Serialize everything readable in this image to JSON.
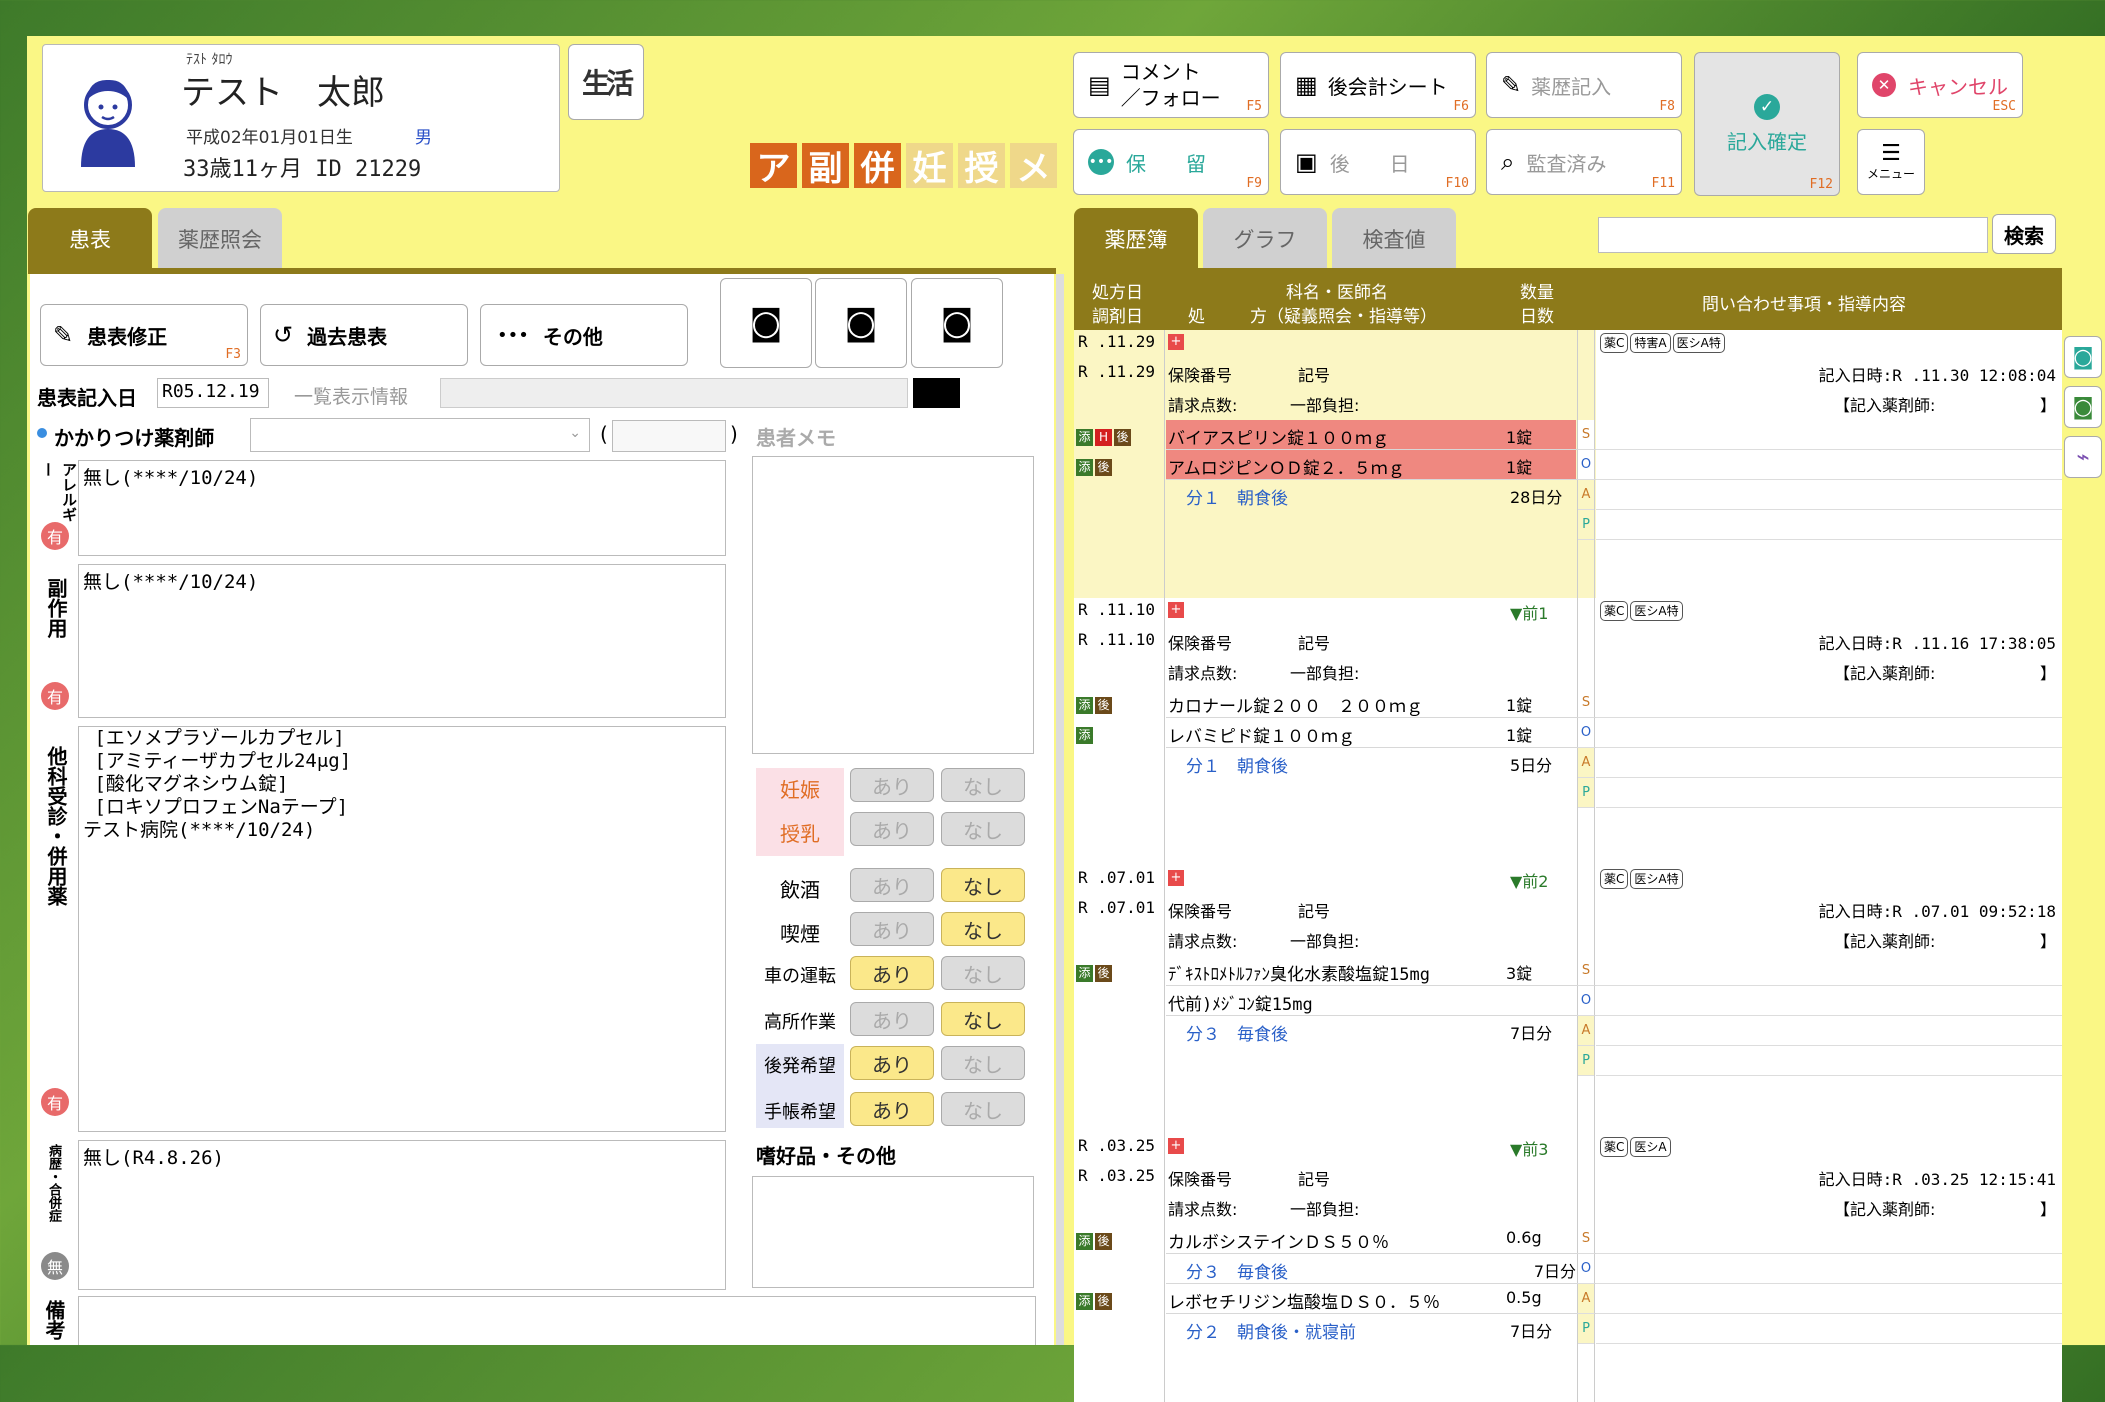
{
  "patient": {
    "kana": "ﾃｽﾄ ﾀﾛｳ",
    "name": "テスト　太郎",
    "birth": "平成02年01月01日生",
    "sex": "男",
    "age_id": "33歳11ヶ月 ID 21229",
    "life_icon": "生活"
  },
  "flags": [
    "ア",
    "副",
    "併",
    "妊",
    "授",
    "メ"
  ],
  "toolbar": {
    "comment": "コメント\n／フォロー",
    "comment_key": "F5",
    "ledger": "後会計シート",
    "ledger_key": "F6",
    "history": "薬歴記入",
    "history_key": "F8",
    "confirm": "記入確定",
    "confirm_key": "F12",
    "cancel": "キャンセル",
    "cancel_key": "ESC",
    "hold": "保　　留",
    "hold_key": "F9",
    "later": "後　　日",
    "later_key": "F10",
    "audited": "監査済み",
    "audited_key": "F11",
    "menu": "メニュー"
  },
  "left_tabs": {
    "tab1": "患表",
    "tab2": "薬歴照会"
  },
  "left_buttons": {
    "edit": "患表修正",
    "edit_key": "F3",
    "past": "過去患表",
    "other": "その他"
  },
  "record_date_label": "患表記入日",
  "record_date": "R05.12.19",
  "list_info_label": "一覧表示情報",
  "pharmacist_label": "かかりつけ薬剤師",
  "memo_label": "患者メモ",
  "sections": {
    "allergy_label": "アレルギー",
    "allergy_text": "無し(****/10/24)",
    "allergy_flag": "有",
    "side_label": "副作用",
    "side_text": "無し(****/10/24)",
    "side_flag": "有",
    "concomitant_label": "他科受診・併用薬",
    "concomitant_text": " [エソメプラゾールカプセル]\n [アミティーザカプセル24μg]\n [酸化マグネシウム錠]\n [ロキソプロフェンNaテープ]\nテスト病院(****/10/24)",
    "concomitant_flag": "有",
    "history_label": "病歴・合併症",
    "history_text": "無し(R4.8.26)",
    "history_flag": "無",
    "remarks_label": "備考"
  },
  "lifestyle": [
    {
      "label": "妊娠",
      "yes": "あり",
      "no": "なし",
      "selected": "none"
    },
    {
      "label": "授乳",
      "yes": "あり",
      "no": "なし",
      "selected": "none"
    },
    {
      "label": "飲酒",
      "yes": "あり",
      "no": "なし",
      "selected": "no"
    },
    {
      "label": "喫煙",
      "yes": "あり",
      "no": "なし",
      "selected": "no"
    },
    {
      "label": "車の運転",
      "yes": "あり",
      "no": "なし",
      "selected": "yes"
    },
    {
      "label": "高所作業",
      "yes": "あり",
      "no": "なし",
      "selected": "no"
    },
    {
      "label": "後発希望",
      "yes": "あり",
      "no": "なし",
      "selected": "yes"
    },
    {
      "label": "手帳希望",
      "yes": "あり",
      "no": "なし",
      "selected": "yes"
    }
  ],
  "hobby_label": "嗜好品・その他",
  "right_tabs": {
    "tab1": "薬歴簿",
    "tab2": "グラフ",
    "tab3": "検査値",
    "search": "検索"
  },
  "table_head": {
    "c1a": "処方日",
    "c1b": "調剤日",
    "c2": "処",
    "c3a": "科名・医師名",
    "c3b": "方（疑義照会・指導等）",
    "c4a": "数量",
    "c4b": "日数",
    "c5": "問い合わせ事項・指導内容"
  },
  "records": [
    {
      "date1": "R .11.29",
      "date2": "R .11.29",
      "prev": "",
      "badges": [
        "薬C",
        "特害A",
        "医シA特"
      ],
      "insurance": "保険番号",
      "symbol": "記号",
      "points": "請求点数:",
      "copay": "一部負担:",
      "entry_time": "記入日時:R .11.30 12:08:04",
      "pharmacist": "【記入薬剤師:",
      "drugs": [
        {
          "name": "バイアスピリン錠１００ｍｇ",
          "qty": "1錠",
          "hl": true,
          "icons": [
            "添",
            "H",
            "後"
          ]
        },
        {
          "name": "アムロジピンＯＤ錠２．５ｍｇ",
          "qty": "1錠",
          "hl": true,
          "icons": [
            "添",
            "後"
          ]
        }
      ],
      "usage": "分１　朝食後",
      "days": "28日分"
    },
    {
      "date1": "R .11.10",
      "date2": "R .11.10",
      "prev": "▼前1",
      "badges": [
        "薬C",
        "医シA特"
      ],
      "insurance": "保険番号",
      "symbol": "記号",
      "points": "請求点数:",
      "copay": "一部負担:",
      "entry_time": "記入日時:R .11.16 17:38:05",
      "pharmacist": "【記入薬剤師:",
      "drugs": [
        {
          "name": "カロナール錠２００　２００ｍｇ",
          "qty": "1錠",
          "hl": false,
          "icons": [
            "添",
            "後"
          ]
        },
        {
          "name": "レバミピド錠１００ｍｇ",
          "qty": "1錠",
          "hl": false,
          "icons": [
            "添"
          ]
        }
      ],
      "usage": "分１　朝食後",
      "days": "5日分"
    },
    {
      "date1": "R .07.01",
      "date2": "R .07.01",
      "prev": "▼前2",
      "badges": [
        "薬C",
        "医シA特"
      ],
      "insurance": "保険番号",
      "symbol": "記号",
      "points": "請求点数:",
      "copay": "一部負担:",
      "entry_time": "記入日時:R .07.01 09:52:18",
      "pharmacist": "【記入薬剤師:",
      "drugs": [
        {
          "name": "ﾃﾞｷｽﾄﾛﾒﾄﾙﾌｧﾝ臭化水素酸塩錠15mg",
          "qty": "3錠",
          "hl": false,
          "icons": [
            "添",
            "後"
          ]
        },
        {
          "name": " 代前)ﾒｼﾞｺﾝ錠15mg",
          "qty": "",
          "hl": false,
          "icons": []
        }
      ],
      "usage": "分３　毎食後",
      "days": "7日分"
    },
    {
      "date1": "R .03.25",
      "date2": "R .03.25",
      "prev": "▼前3",
      "badges": [
        "薬C",
        "医シA"
      ],
      "insurance": "保険番号",
      "symbol": "記号",
      "points": "請求点数:",
      "copay": "一部負担:",
      "entry_time": "記入日時:R .03.25 12:15:41",
      "pharmacist": "【記入薬剤師:",
      "drugs": [
        {
          "name": "カルボシステインＤＳ５０％",
          "qty": "0.6g",
          "hl": false,
          "icons": [
            "添",
            "後"
          ]
        },
        {
          "name": "分３　毎食後",
          "qty": "7日分",
          "hl": false,
          "icons": [],
          "usage": true
        },
        {
          "name": "レボセチリジン塩酸塩ＤＳ０．５％",
          "qty": "0.5g",
          "hl": false,
          "icons": [
            "添",
            "後"
          ]
        }
      ],
      "usage": "分２　朝食後・就寝前",
      "days": "7日分"
    }
  ],
  "soap": [
    "S",
    "O",
    "A",
    "P"
  ],
  "colors": {
    "bg": "#faf785",
    "tab_on": "#8d7a1a",
    "highlight": "#ef8880",
    "accent_orange": "#d9661c",
    "note_yellow": "#fbf6c4"
  }
}
